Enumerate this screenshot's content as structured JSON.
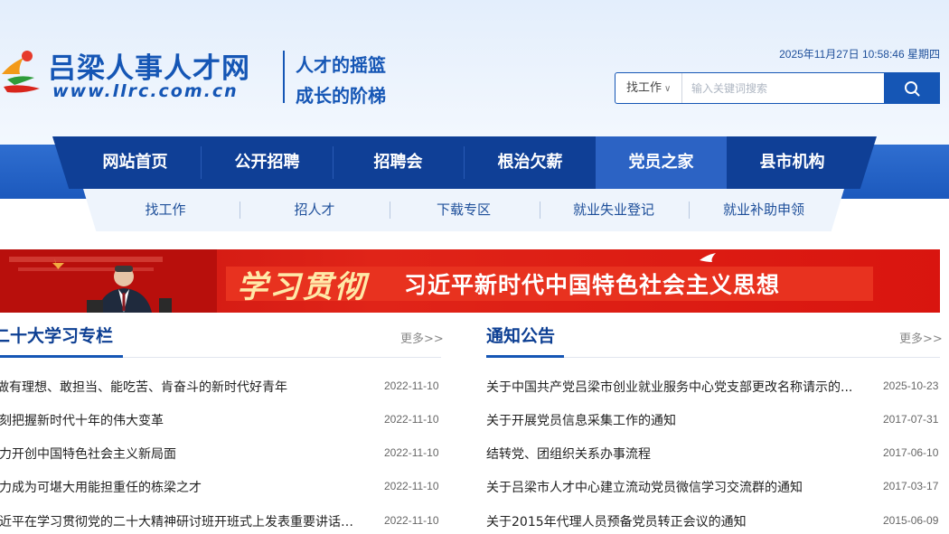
{
  "header": {
    "site_name": "吕梁人事人才网",
    "site_url": "www.llrc.com.cn",
    "slogan_line1": "人才的摇篮",
    "slogan_line2": "成长的阶梯",
    "datetime": "2025年11月27日 10:58:46 星期四",
    "logo_icon": "llrc-logo-icon"
  },
  "search": {
    "type_label": "找工作",
    "placeholder": "输入关键词搜索",
    "button_icon": "search-icon"
  },
  "nav": {
    "items": [
      "网站首页",
      "公开招聘",
      "招聘会",
      "根治欠薪",
      "党员之家",
      "县市机构"
    ],
    "active_index": 4
  },
  "subnav": {
    "items": [
      "找工作",
      "招人才",
      "下载专区",
      "就业失业登记",
      "就业补助申领"
    ]
  },
  "banner": {
    "calligraphy": "学习贯彻",
    "text": "习近平新时代中国特色社会主义思想"
  },
  "study_column": {
    "title": "二十大学习专栏",
    "more": "更多>>",
    "items": [
      {
        "title": "做有理想、敢担当、能吃苦、肯奋斗的新时代好青年",
        "date": "2022-11-10"
      },
      {
        "title": "深刻把握新时代十年的伟大变革",
        "date": "2022-11-10"
      },
      {
        "title": "努力开创中国特色社会主义新局面",
        "date": "2022-11-10"
      },
      {
        "title": "努力成为可堪大用能担重任的栋梁之才",
        "date": "2022-11-10"
      },
      {
        "title": "习近平在学习贯彻党的二十大精神研讨班开班式上发表重要讲话…",
        "date": "2022-11-10"
      }
    ]
  },
  "notices": {
    "title": "通知公告",
    "more": "更多>>",
    "items": [
      {
        "title": "关于中国共产党吕梁市创业就业服务中心党支部更改名称请示的...",
        "date": "2025-10-23"
      },
      {
        "title": "关于开展党员信息采集工作的通知",
        "date": "2017-07-31"
      },
      {
        "title": "结转党、团组织关系办事流程",
        "date": "2017-06-10"
      },
      {
        "title": "关于吕梁市人才中心建立流动党员微信学习交流群的通知",
        "date": "2017-03-17"
      },
      {
        "title": "关于2015年代理人员预备党员转正会议的通知",
        "date": "2015-06-09"
      }
    ]
  },
  "colors": {
    "brand_blue": "#1556b5",
    "nav_dark": "#0f3f96",
    "nav_active": "#2c63c4",
    "banner_red": "#d9150f"
  }
}
